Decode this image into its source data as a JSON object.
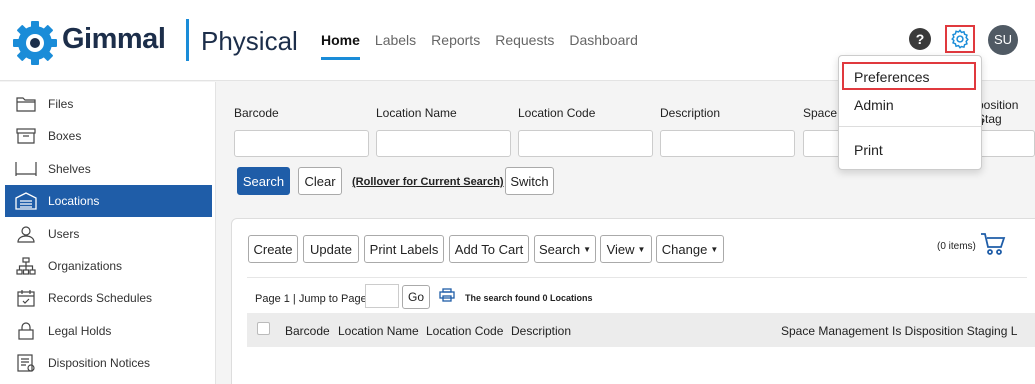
{
  "header": {
    "brand": "Gimmal",
    "product": "Physical",
    "nav": [
      "Home",
      "Labels",
      "Reports",
      "Requests",
      "Dashboard"
    ],
    "active_nav": "Home",
    "help_label": "?",
    "avatar_initials": "SU",
    "accent_color": "#1a8cd8"
  },
  "sidebar": {
    "items": [
      {
        "label": "Files",
        "icon": "folder-icon"
      },
      {
        "label": "Boxes",
        "icon": "box-icon"
      },
      {
        "label": "Shelves",
        "icon": "shelf-icon"
      },
      {
        "label": "Locations",
        "icon": "warehouse-icon",
        "active": true
      },
      {
        "label": "Users",
        "icon": "user-icon"
      },
      {
        "label": "Organizations",
        "icon": "org-chart-icon"
      },
      {
        "label": "Records Schedules",
        "icon": "calendar-icon"
      },
      {
        "label": "Legal Holds",
        "icon": "lock-icon"
      },
      {
        "label": "Disposition Notices",
        "icon": "notice-icon"
      }
    ]
  },
  "filters": {
    "fields": [
      "Barcode",
      "Location Name",
      "Location Code",
      "Description",
      "Space M",
      "position Stag"
    ],
    "field_extra": "n",
    "search_label": "Search",
    "clear_label": "Clear",
    "rollover_label": "(Rollover for Current Search)",
    "switch_label": "Switch"
  },
  "toolbar": {
    "create": "Create",
    "update": "Update",
    "print_labels": "Print Labels",
    "add_to_cart": "Add To Cart",
    "search": "Search",
    "view": "View",
    "change": "Change",
    "items_count": "(0 items)"
  },
  "pager": {
    "text": "Page 1 | Jump to Page:",
    "go": "Go",
    "status": "The search found 0 Locations"
  },
  "table": {
    "columns": [
      "Barcode",
      "Location Name",
      "Location Code",
      "Description",
      "Space Management",
      "Is Disposition Staging L"
    ]
  },
  "settings_menu": {
    "items": [
      "Preferences",
      "Admin",
      "Print"
    ],
    "highlight_color": "#e0393e"
  }
}
